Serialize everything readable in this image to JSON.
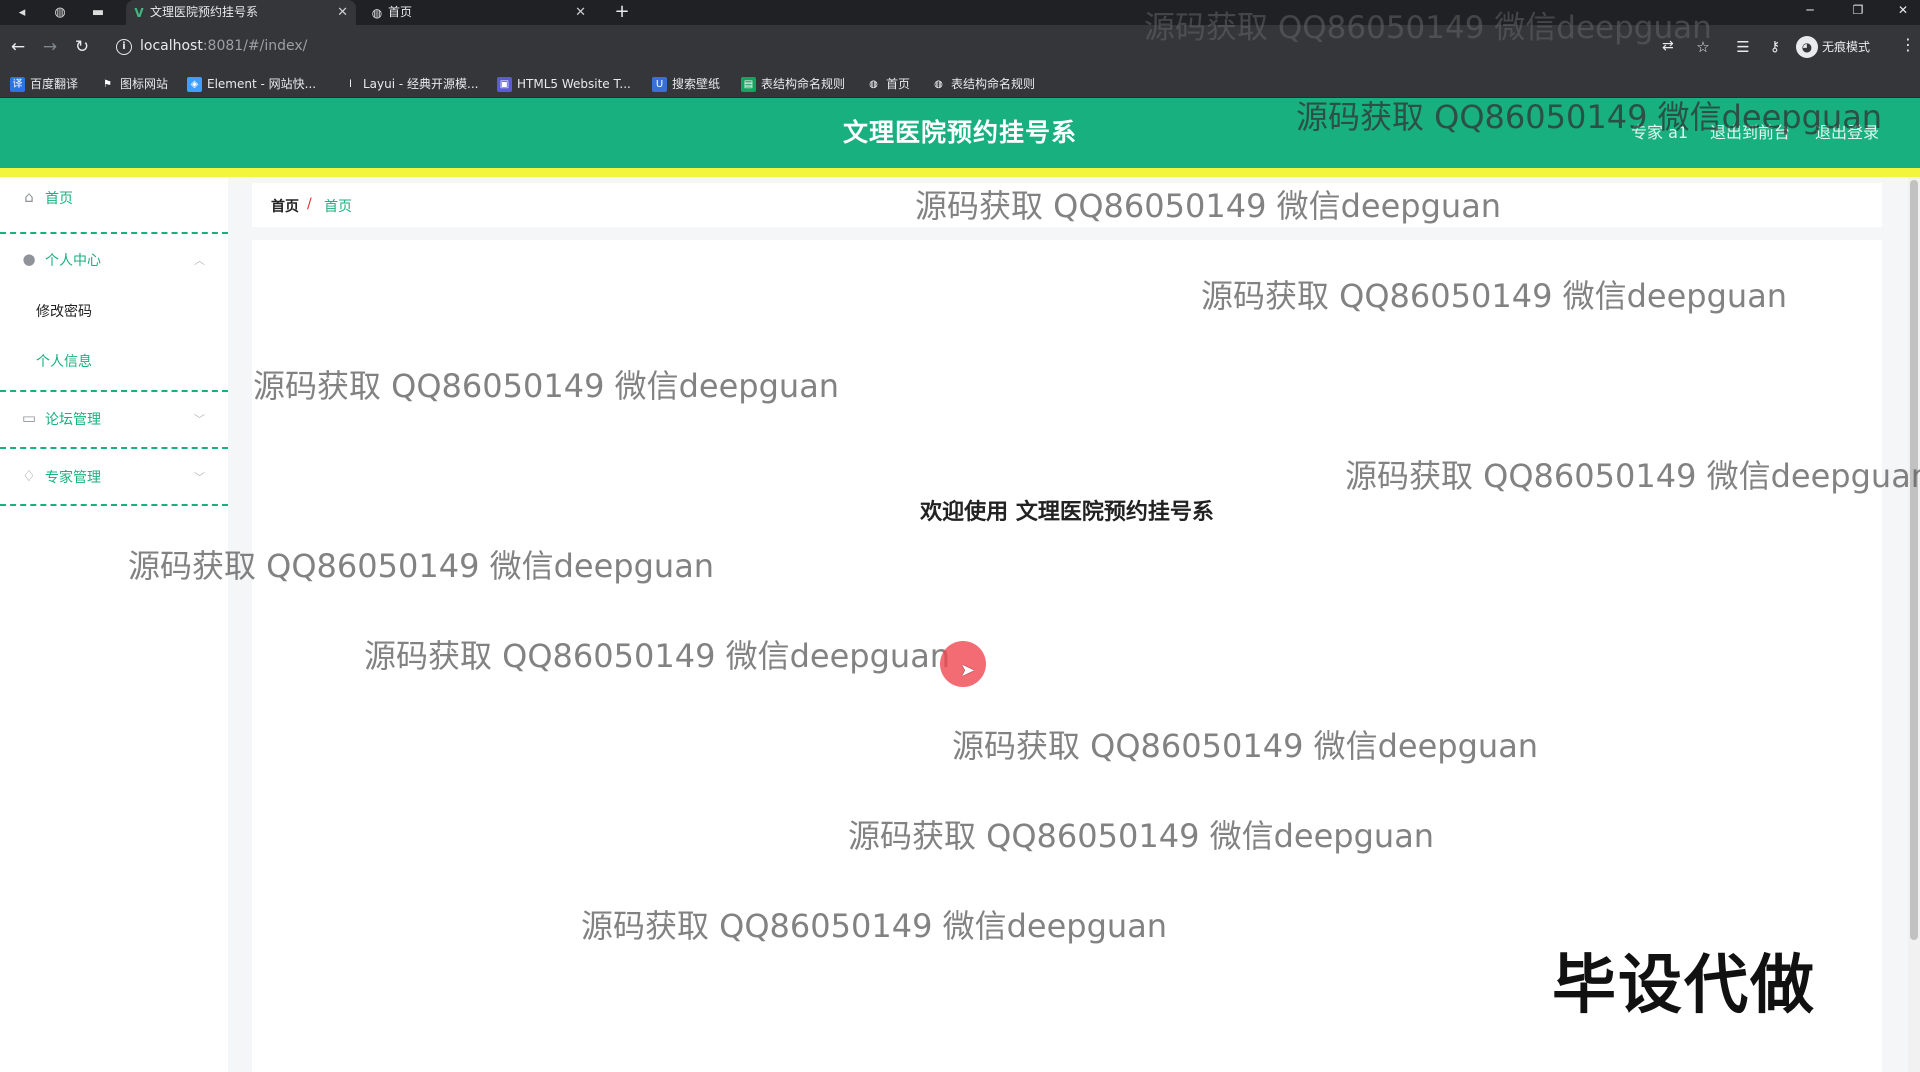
{
  "browser": {
    "tabs": [
      {
        "title": "文理医院预约挂号系",
        "active": true
      },
      {
        "title": "首页",
        "active": false
      }
    ],
    "url_host": "localhost",
    "url_rest": ":8081/#/index/",
    "incognito_label": "无痕模式",
    "bookmarks": [
      {
        "label": "百度翻译",
        "icon": "baidu-translate-icon",
        "color": "#2b74e8"
      },
      {
        "label": "图标网站",
        "icon": "flag-icon",
        "color": "#35363a"
      },
      {
        "label": "Element - 网站快...",
        "icon": "element-icon",
        "color": "#409eff"
      },
      {
        "label": "Layui - 经典开源模...",
        "icon": "layui-icon",
        "color": "#35363a"
      },
      {
        "label": "HTML5 Website T...",
        "icon": "html5-template-icon",
        "color": "#5b5bd6"
      },
      {
        "label": "搜索壁纸",
        "icon": "wallpaper-icon",
        "color": "#3b6fd8"
      },
      {
        "label": "表结构命名规则",
        "icon": "table-naming-icon",
        "color": "#1aa260"
      },
      {
        "label": "首页",
        "icon": "globe-icon",
        "color": "#35363a"
      },
      {
        "label": "表结构命名规则",
        "icon": "globe-icon",
        "color": "#35363a"
      }
    ]
  },
  "header": {
    "title": "文理医院预约挂号系",
    "user": "专家 a1",
    "back_to_front": "退出到前台",
    "logout": "退出登录"
  },
  "sidebar": {
    "home": "首页",
    "personal_center": "个人中心",
    "change_password": "修改密码",
    "personal_info": "个人信息",
    "forum_mgmt": "论坛管理",
    "expert_mgmt": "专家管理"
  },
  "breadcrumb": {
    "root": "首页",
    "separator": "/",
    "current": "首页"
  },
  "main": {
    "welcome": "欢迎使用 文理医院预约挂号系"
  },
  "overlay": {
    "watermark": "源码获取 QQ86050149 微信deepguan",
    "promo": "毕设代做"
  },
  "colors": {
    "brand": "#19b07f",
    "accent_bar": "#f3f53d"
  }
}
